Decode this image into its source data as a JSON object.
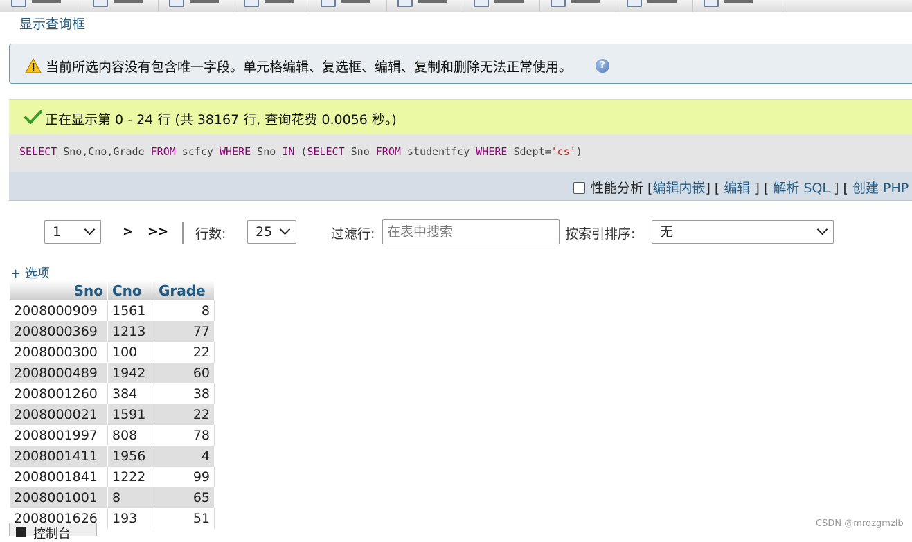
{
  "top_link": {
    "show_query": "显示查询框"
  },
  "warning": {
    "text": "当前所选内容没有包含唯一字段。单元格编辑、复选框、编辑、复制和删除无法正常使用。"
  },
  "success": {
    "text": "正在显示第 0 - 24 行 (共 38167 行, 查询花费 0.0056 秒。)"
  },
  "sql": {
    "kw_select1": "SELECT",
    "t1": " Sno,Cno,Grade ",
    "kw_from1": "FROM",
    "t2": " scfcy ",
    "kw_where1": "WHERE",
    "t3": " Sno ",
    "kw_in": "IN",
    "t4": " (",
    "kw_select2": "SELECT",
    "t5": " Sno ",
    "kw_from2": "FROM",
    "t6": " studentfcy ",
    "kw_where2": "WHERE",
    "t7": " Sdept=",
    "string": "'cs'",
    "t8": ")"
  },
  "actions": {
    "profiling": "性能分析",
    "open1": " [",
    "edit_inline": "编辑内嵌",
    "sep1": "] [ ",
    "edit": "编辑",
    "sep2": " ] [ ",
    "explain": "解析 SQL",
    "sep3": " ] [ ",
    "create_php": "创建 PHP"
  },
  "nav": {
    "page_value": "1",
    "next": ">",
    "last": ">>",
    "rows_label": "行数:",
    "rows_value": "25",
    "filter_label": "过滤行:",
    "filter_placeholder": "在表中搜索",
    "sort_label": "按索引排序:",
    "sort_value": "无"
  },
  "options_link": "+ 选项",
  "table": {
    "headers": [
      "Sno",
      "Cno",
      "Grade"
    ],
    "rows": [
      [
        "2008000909",
        "1561",
        "8"
      ],
      [
        "2008000369",
        "1213",
        "77"
      ],
      [
        "2008000300",
        "100",
        "22"
      ],
      [
        "2008000489",
        "1942",
        "60"
      ],
      [
        "2008001260",
        "384",
        "38"
      ],
      [
        "2008000021",
        "1591",
        "22"
      ],
      [
        "2008001997",
        "808",
        "78"
      ],
      [
        "2008001411",
        "1956",
        "4"
      ],
      [
        "2008001841",
        "1222",
        "99"
      ],
      [
        "2008001001",
        "8",
        "65"
      ],
      [
        "2008001626",
        "193",
        "51"
      ]
    ]
  },
  "console": {
    "label": "控制台"
  },
  "watermark": "CSDN @mrqzgmzlb",
  "colors": {
    "link": "#235a81",
    "success_bg": "#ebf8a4",
    "warning_border": "#5f9bbd",
    "keyword": "#90007a"
  }
}
